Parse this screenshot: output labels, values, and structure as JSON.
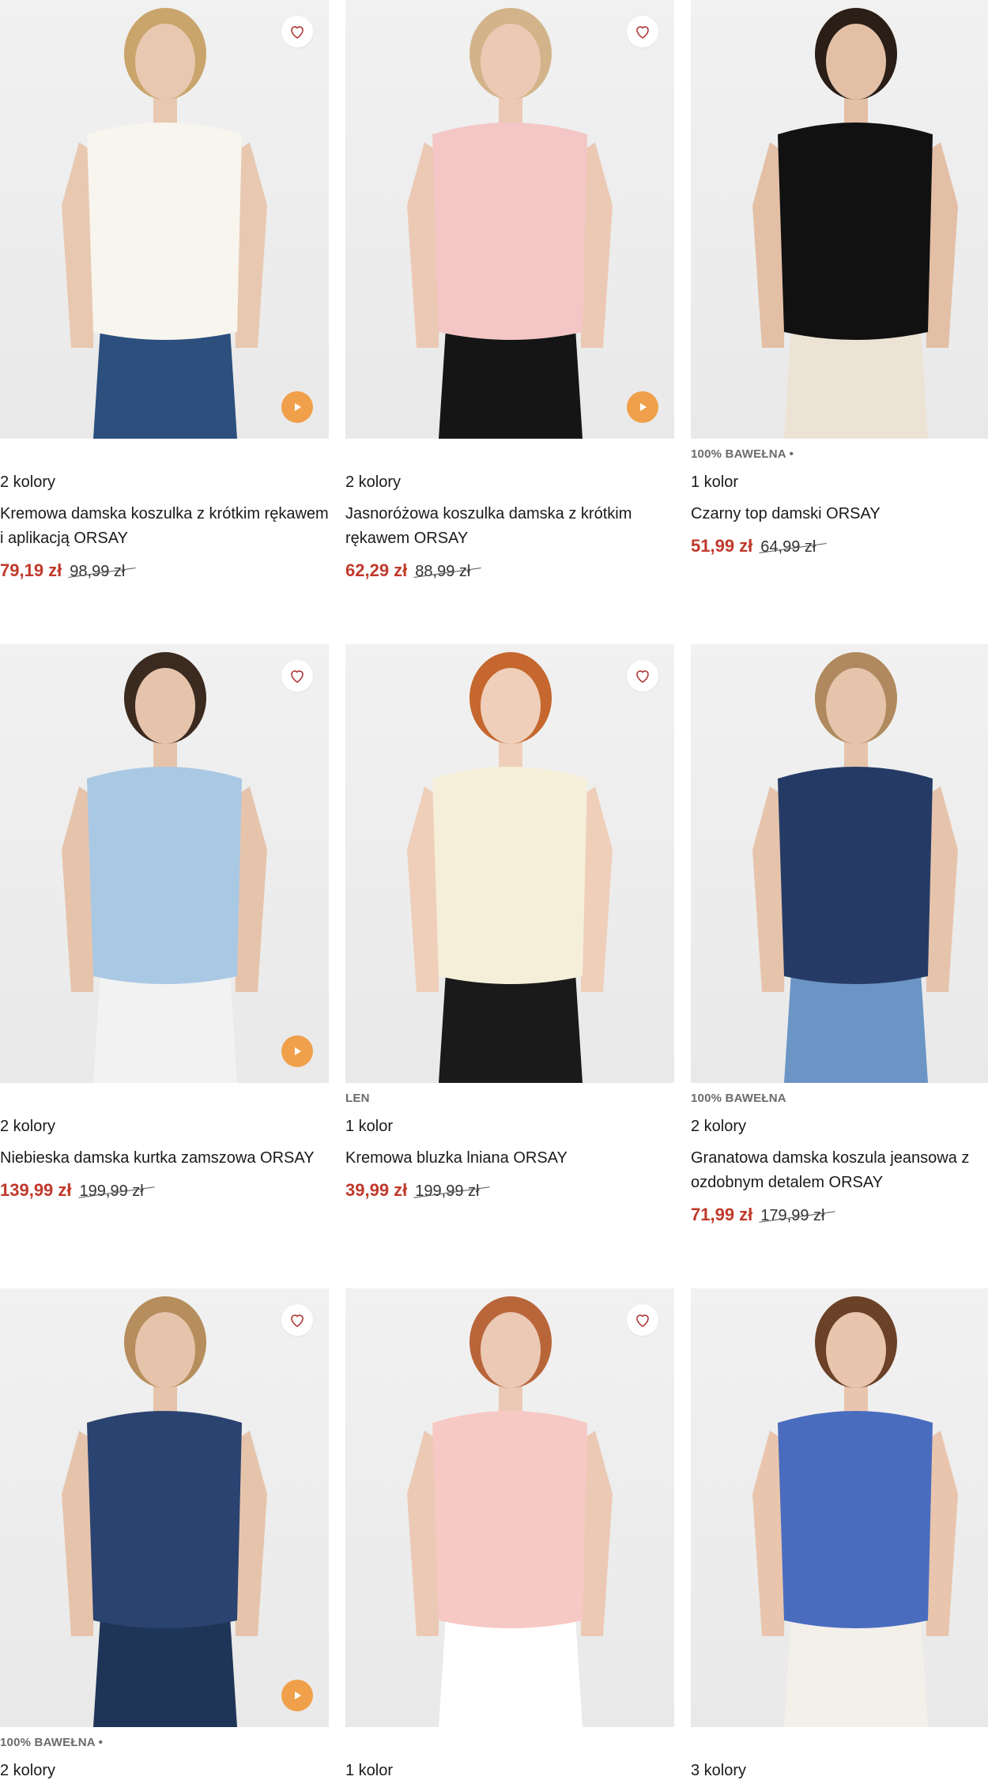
{
  "products": [
    {
      "meta": "",
      "colors": "2 kolory",
      "name": "Kremowa damska koszulka z krótkim rękawem i aplikacją ORSAY",
      "price": "79,19 zł",
      "old_price": "98,99 zł",
      "palette": {
        "top": "#f7f5ee",
        "bottom": "#2c4f7e",
        "hair": "#c9a46b",
        "skin": "#e8c8b0"
      }
    },
    {
      "meta": "",
      "colors": "2 kolory",
      "name": "Jasnoróżowa koszulka damska z krótkim rękawem ORSAY",
      "price": "62,29 zł",
      "old_price": "88,99 zł",
      "palette": {
        "top": "#f4c6c6",
        "bottom": "#151515",
        "hair": "#d3b48a",
        "skin": "#ecc9b5"
      }
    },
    {
      "meta": "100% BAWEŁNA •",
      "colors": "1 kolor",
      "name": "Czarny top damski ORSAY",
      "price": "51,99 zł",
      "old_price": "64,99 zł",
      "palette": {
        "top": "#111111",
        "bottom": "#ece3d4",
        "hair": "#2a1e16",
        "skin": "#e3bfa6"
      }
    },
    {
      "meta": "",
      "colors": "2 kolory",
      "name": "Niebieska damska kurtka zamszowa ORSAY",
      "price": "139,99 zł",
      "old_price": "199,99 zł",
      "palette": {
        "top": "#a9c8e4",
        "bottom": "#f2f2f2",
        "hair": "#3b2a1f",
        "skin": "#e6c4ac"
      }
    },
    {
      "meta": "LEN",
      "colors": "1 kolor",
      "name": "Kremowa bluzka lniana ORSAY",
      "price": "39,99 zł",
      "old_price": "199,99 zł",
      "palette": {
        "top": "#f5efd9",
        "bottom": "#1a1a1a",
        "hair": "#c5672e",
        "skin": "#efcfba"
      }
    },
    {
      "meta": "100% BAWEŁNA",
      "colors": "2 kolory",
      "name": "Granatowa damska koszula jeansowa z ozdobnym detalem ORSAY",
      "price": "71,99 zł",
      "old_price": "179,99 zł",
      "palette": {
        "top": "#253b66",
        "bottom": "#6b95c5",
        "hair": "#b08a5e",
        "skin": "#e6c4ac"
      }
    },
    {
      "meta": "100% BAWEŁNA •",
      "colors": "2 kolory",
      "name": "",
      "price": "",
      "old_price": "",
      "palette": {
        "top": "#2b4370",
        "bottom": "#1f3557",
        "hair": "#b68d5c",
        "skin": "#e6c4ac"
      }
    },
    {
      "meta": "",
      "colors": "1 kolor",
      "name": "",
      "price": "",
      "old_price": "",
      "palette": {
        "top": "#f7c9c4",
        "bottom": "#ffffff",
        "hair": "#b9653a",
        "skin": "#ecc9b5"
      }
    },
    {
      "meta": "",
      "colors": "3 kolory",
      "name": "",
      "price": "",
      "old_price": "",
      "palette": {
        "top": "#4a6cbf",
        "bottom": "#f3f0ea",
        "hair": "#6b4128",
        "skin": "#e9c5ad"
      }
    }
  ],
  "accent": "#f0a04b",
  "price_color": "#c0392b",
  "icons": {
    "favorite": "heart-outline-icon",
    "video": "play-icon"
  }
}
